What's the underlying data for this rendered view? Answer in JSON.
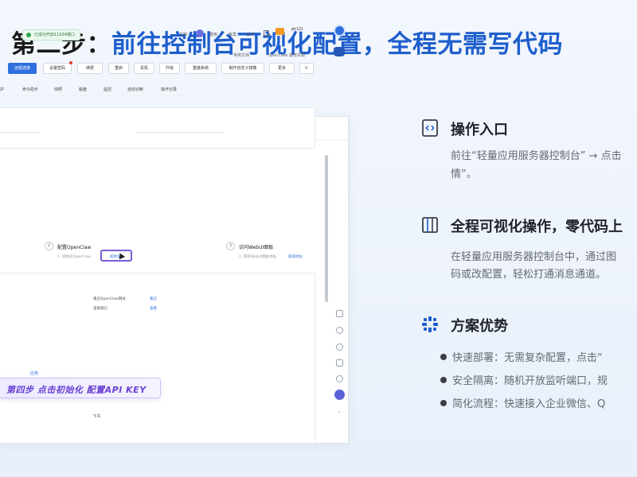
{
  "slide": {
    "title_prefix": "第二步：",
    "title_main": "前往控制台可视化配置，全程无需写代码"
  },
  "screenshot": {
    "toast": "已成功开启11934端口",
    "top_nav": [
      "文档",
      "费用",
      "备案",
      "工单"
    ],
    "username": "ph12l",
    "help_links": [
      "常用文档",
      "OpenClaw 最佳实践"
    ],
    "buttons": [
      "远程连接",
      "设置密码",
      "续费",
      "重启",
      "关机",
      "升级",
      "重装系统",
      "制作自定义镜像",
      "更多"
    ],
    "subtabs": [
      "护",
      "命令助手",
      "快照",
      "磁盘",
      "监控",
      "自动诊断",
      "操作记录"
    ],
    "steps": [
      {
        "num": "2",
        "title": "配置OpenClaw",
        "desc": "1. 初始化OpenClaw",
        "link": "初始化"
      },
      {
        "num": "3",
        "title": "访问WebUI面板",
        "desc": "1. 获取WebUI面板地址",
        "link": "获取地址"
      }
    ],
    "kv": [
      {
        "label": "重启OpenClaw网关",
        "link": "重启"
      },
      {
        "label": "查看端口",
        "link": "查看"
      }
    ],
    "mini_labels": [
      "应用",
      "飞书"
    ],
    "banner": "第四步 点击初始化 配置API KEY"
  },
  "features": [
    {
      "icon": "code-icon",
      "title": "操作入口",
      "desc": [
        "前往“轻量应用服务器控制台” → 点击",
        "情”。"
      ]
    },
    {
      "icon": "layout-icon",
      "title": "全程可视化操作，零代码上",
      "desc": [
        "在轻量应用服务器控制台中，通过图",
        "码或改配置，轻松打通消息通道。"
      ]
    },
    {
      "icon": "grid-icon",
      "title": "方案优势",
      "bullets": [
        "快速部署：无需复杂配置，点击“",
        "安全隔离：随机开放监听端口，规",
        "简化流程：快速接入企业微信、Q"
      ]
    }
  ],
  "colors": {
    "accent": "#1f5fcc",
    "primary_button": "#2f6fe0",
    "banner_text": "#6a3fd1"
  }
}
